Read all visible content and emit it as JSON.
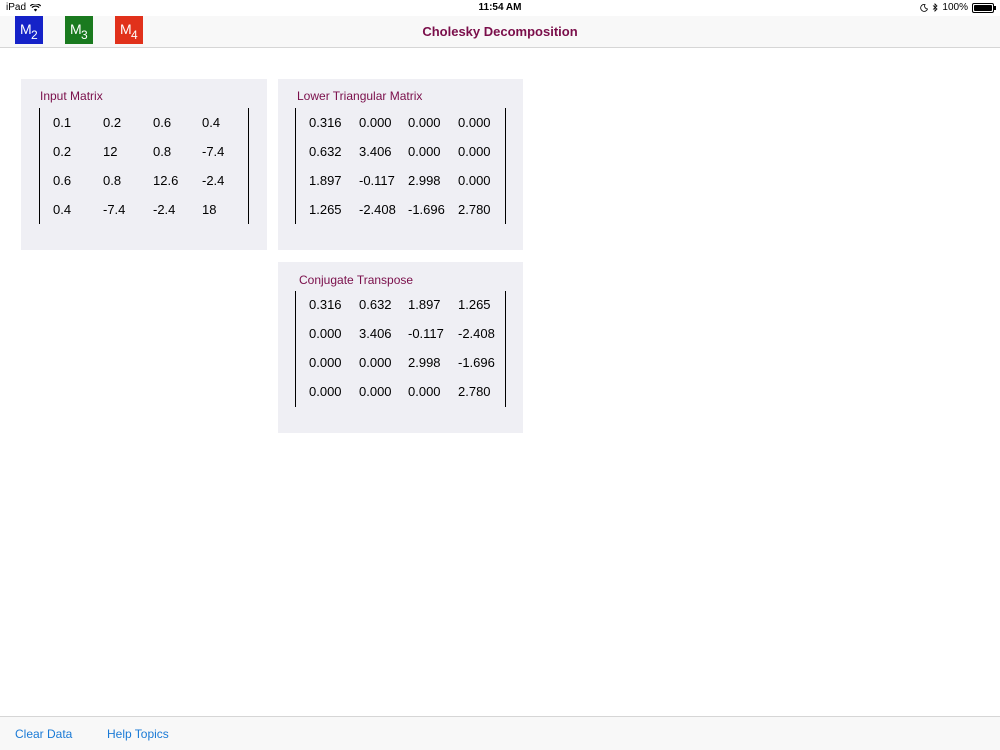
{
  "status_bar": {
    "device": "iPad",
    "time": "11:54 AM",
    "battery": "100%"
  },
  "nav": {
    "title": "Cholesky Decomposition",
    "buttons": [
      {
        "letter": "M",
        "sub": "2",
        "color": "#1522c8"
      },
      {
        "letter": "M",
        "sub": "3",
        "color": "#1a7a1f"
      },
      {
        "letter": "M",
        "sub": "4",
        "color": "#e1311b"
      }
    ]
  },
  "input_matrix": {
    "title": "Input Matrix",
    "rows": [
      [
        "0.1",
        "0.2",
        "0.6",
        "0.4"
      ],
      [
        "0.2",
        "12",
        "0.8",
        "-7.4"
      ],
      [
        "0.6",
        "0.8",
        "12.6",
        "-2.4"
      ],
      [
        "0.4",
        "-7.4",
        "-2.4",
        "18"
      ]
    ]
  },
  "lower_matrix": {
    "title": "Lower Triangular Matrix",
    "rows": [
      [
        "0.316",
        "0.000",
        "0.000",
        "0.000"
      ],
      [
        "0.632",
        "3.406",
        "0.000",
        "0.000"
      ],
      [
        "1.897",
        "-0.117",
        "2.998",
        "0.000"
      ],
      [
        "1.265",
        "-2.408",
        "-1.696",
        "2.780"
      ]
    ]
  },
  "conjugate_matrix": {
    "title": "Conjugate Transpose",
    "rows": [
      [
        "0.316",
        "0.632",
        "1.897",
        "1.265"
      ],
      [
        "0.000",
        "3.406",
        "-0.117",
        "-2.408"
      ],
      [
        "0.000",
        "0.000",
        "2.998",
        "-1.696"
      ],
      [
        "0.000",
        "0.000",
        "0.000",
        "2.780"
      ]
    ]
  },
  "toolbar": {
    "clear_label": "Clear Data",
    "help_label": "Help Topics"
  }
}
